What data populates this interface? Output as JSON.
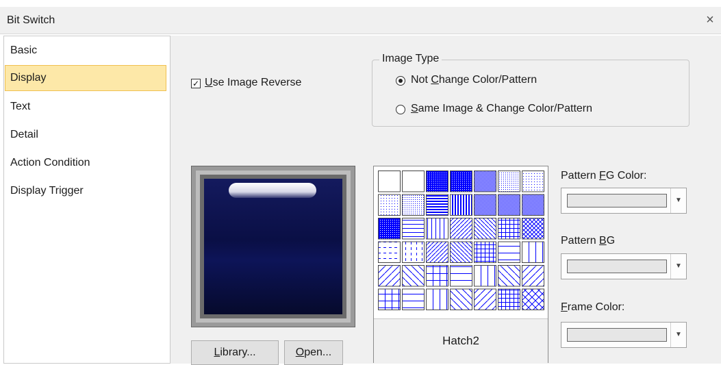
{
  "window": {
    "title": "Bit Switch",
    "close_glyph": "×"
  },
  "nav": {
    "items": [
      {
        "label": "Basic",
        "selected": false
      },
      {
        "label": "Display",
        "selected": true
      },
      {
        "label": "Text",
        "selected": false
      },
      {
        "label": "Detail",
        "selected": false
      },
      {
        "label": "Action Condition",
        "selected": false
      },
      {
        "label": "Display Trigger",
        "selected": false
      }
    ]
  },
  "display": {
    "use_image_reverse": {
      "checked": true,
      "label_u": "U",
      "label_rest": "se Image Reverse"
    },
    "image_type": {
      "title": "Image Type",
      "options": [
        {
          "pre": "Not ",
          "u": "C",
          "post": "hange Color/Pattern",
          "selected": true
        },
        {
          "pre": "",
          "u": "S",
          "post": "ame Image & Change Color/Pattern",
          "selected": false
        }
      ]
    },
    "library_button": {
      "u": "L",
      "rest": "ibrary..."
    },
    "open_button": {
      "u": "O",
      "rest": "pen..."
    },
    "pattern": {
      "selected_name": "Hatch2",
      "fg_color": "#0000ff"
    },
    "pattern_fg": {
      "pre": "Pattern ",
      "u": "F",
      "post": "G Color:",
      "value": "#e6e6e6"
    },
    "pattern_bg": {
      "pre": "Pattern ",
      "u": "B",
      "post": "G",
      "value": "#e6e6e6"
    },
    "frame_color": {
      "pre": "",
      "u": "F",
      "post": "rame Color:",
      "value": "#e6e6e6"
    }
  },
  "colors": {
    "selection_bg": "#fde8a8",
    "selection_border": "#f0c050",
    "panel_bg": "#f0f0f0",
    "accent_blue": "#0000ff"
  }
}
